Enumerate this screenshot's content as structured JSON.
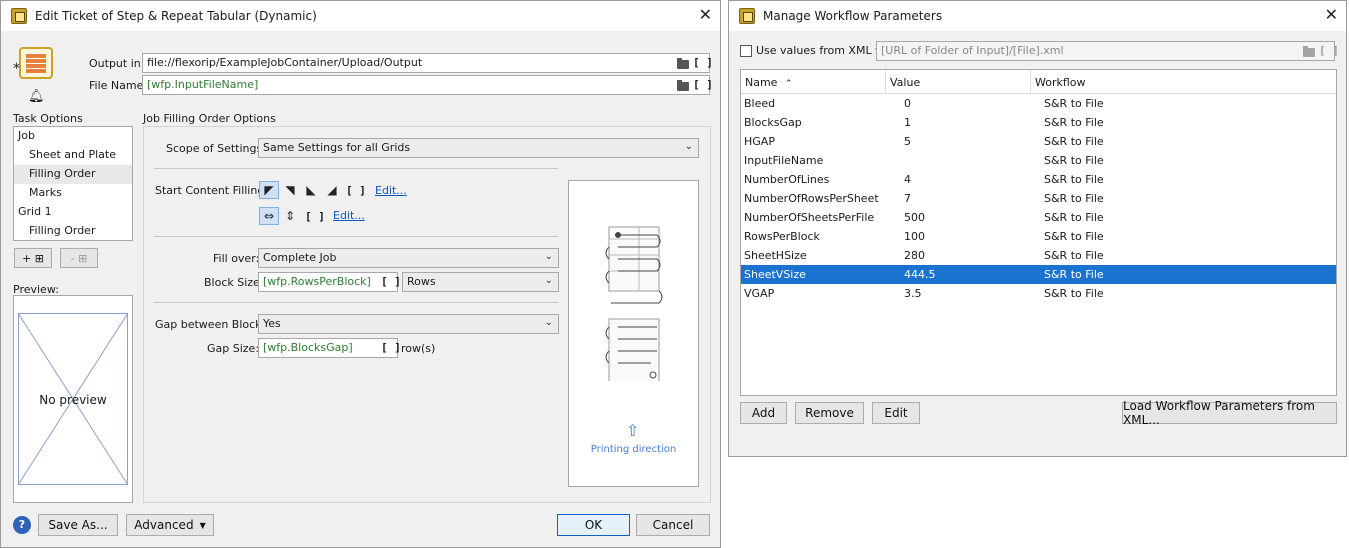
{
  "ticket": {
    "title": "Edit Ticket of Step & Repeat Tabular (Dynamic)",
    "output_in_label": "Output in:",
    "output_in_value": "file://flexorip/ExampleJobContainer/Upload/Output",
    "file_name_label": "File Name:",
    "file_name_value": "[wfp.InputFileName]",
    "var_glyph": "[ ]",
    "task_options_label": "Task Options",
    "tree": [
      {
        "label": "Job"
      },
      {
        "label": "Sheet and Plate"
      },
      {
        "label": "Filling Order"
      },
      {
        "label": "Marks"
      },
      {
        "label": "Grid 1"
      },
      {
        "label": "Filling Order"
      }
    ],
    "add_button": "+ ⊞",
    "remove_button": "- ⊞",
    "preview_label": "Preview:",
    "no_preview": "No preview",
    "section_title": "Job Filling Order Options",
    "scope_label": "Scope of Settings:",
    "scope_value": "Same Settings for all Grids",
    "start_filling_label": "Start Content Filling:",
    "edit_link_1": "Edit...",
    "edit_link_2": "Edit...",
    "fill_over_label": "Fill over:",
    "fill_over_value": "Complete Job",
    "block_size_label": "Block Size:",
    "block_size_value": "[wfp.RowsPerBlock]",
    "block_unit": "Rows",
    "gap_blocks_label": "Gap between Blocks:",
    "gap_blocks_value": "Yes",
    "gap_size_label": "Gap Size:",
    "gap_size_value": "[wfp.BlocksGap]",
    "gap_unit": "row(s)",
    "printing_direction": "Printing direction",
    "save_as": "Save As...",
    "advanced": "Advanced",
    "ok": "OK",
    "cancel": "Cancel"
  },
  "wfp": {
    "title": "Manage Workflow Parameters",
    "use_xml_label": "Use values from XML file",
    "xml_placeholder": "[URL of Folder of Input]/[File].xml",
    "col_name": "Name",
    "col_value": "Value",
    "col_workflow": "Workflow",
    "rows": [
      {
        "name": "Bleed",
        "value": "0",
        "workflow": "S&R to File"
      },
      {
        "name": "BlocksGap",
        "value": "1",
        "workflow": "S&R to File"
      },
      {
        "name": "HGAP",
        "value": "5",
        "workflow": "S&R to File"
      },
      {
        "name": "InputFileName",
        "value": "",
        "workflow": "S&R to File"
      },
      {
        "name": "NumberOfLines",
        "value": "4",
        "workflow": "S&R to File"
      },
      {
        "name": "NumberOfRowsPerSheet",
        "value": "7",
        "workflow": "S&R to File"
      },
      {
        "name": "NumberOfSheetsPerFile",
        "value": "500",
        "workflow": "S&R to File"
      },
      {
        "name": "RowsPerBlock",
        "value": "100",
        "workflow": "S&R to File"
      },
      {
        "name": "SheetHSize",
        "value": "280",
        "workflow": "S&R to File"
      },
      {
        "name": "SheetVSize",
        "value": "444.5",
        "workflow": "S&R to File"
      },
      {
        "name": "VGAP",
        "value": "3.5",
        "workflow": "S&R to File"
      }
    ],
    "selected_index": 9,
    "add": "Add",
    "remove": "Remove",
    "edit": "Edit",
    "load": "Load Workflow Parameters from XML..."
  },
  "colors": {
    "selection": "#1a73d0",
    "link": "#0b57c5",
    "variable_text": "#2e7d32"
  }
}
